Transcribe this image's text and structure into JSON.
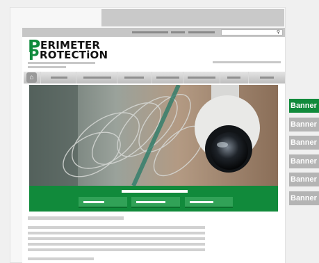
{
  "logo": {
    "initial_top": "P",
    "initial_bottom": "P",
    "line1": "ERIMETER",
    "line2": "ROTECTiON"
  },
  "search": {
    "icon": "search-icon",
    "glyph": "⚲"
  },
  "nav": {
    "home_icon": "home-icon",
    "home_glyph": "⌂"
  },
  "banners": [
    {
      "label": "Banner",
      "color": "#118a3b"
    },
    {
      "label": "Banner",
      "color": "#b4b4b4"
    },
    {
      "label": "Banner",
      "color": "#b4b4b4"
    },
    {
      "label": "Banner",
      "color": "#b4b4b4"
    },
    {
      "label": "Banner",
      "color": "#b4b4b4"
    },
    {
      "label": "Banner",
      "color": "#b4b4b4"
    }
  ],
  "colors": {
    "brand_green": "#118a3b",
    "placeholder_gray": "#c6c6c6"
  }
}
